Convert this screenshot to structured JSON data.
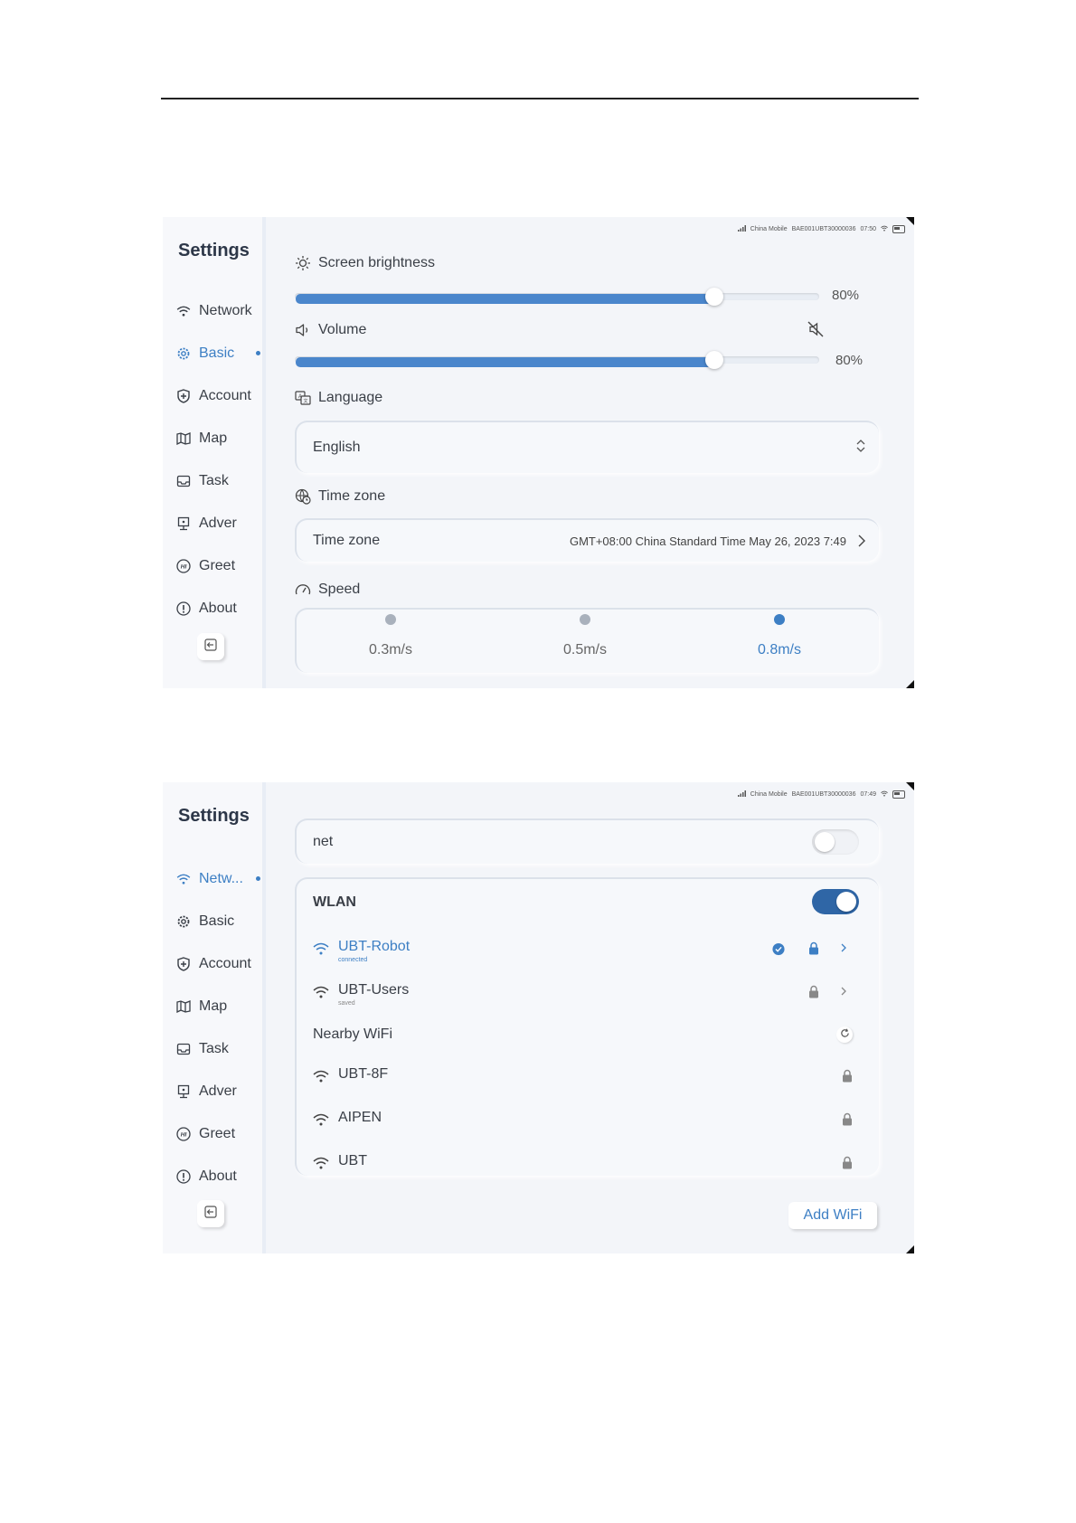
{
  "settings_screen": {
    "status_bar": {
      "carrier": "China Mobile",
      "device_id": "BAE001UBT30000036",
      "time": "07:50"
    },
    "sidebar": {
      "title": "Settings",
      "items": [
        {
          "label": "Network",
          "icon": "wifi-icon"
        },
        {
          "label": "Basic",
          "icon": "gear-icon",
          "active": true
        },
        {
          "label": "Account",
          "icon": "shield-icon"
        },
        {
          "label": "Map",
          "icon": "map-icon"
        },
        {
          "label": "Task",
          "icon": "inbox-icon"
        },
        {
          "label": "Adver",
          "icon": "billboard-icon"
        },
        {
          "label": "Greet",
          "icon": "hi-icon"
        },
        {
          "label": "About",
          "icon": "info-icon"
        }
      ]
    },
    "brightness": {
      "label": "Screen brightness",
      "value_text": "80%",
      "level": 0.8
    },
    "volume": {
      "label": "Volume",
      "value_text": "80%",
      "level": 0.8,
      "mute_icon": "mute-icon"
    },
    "language": {
      "label": "Language",
      "selected": "English"
    },
    "timezone": {
      "label": "Time zone",
      "row_label": "Time zone",
      "value": "GMT+08:00 China Standard Time  May 26, 2023  7:49"
    },
    "speed": {
      "label": "Speed",
      "options": [
        {
          "label": "0.3m/s",
          "selected": false
        },
        {
          "label": "0.5m/s",
          "selected": false
        },
        {
          "label": "0.8m/s",
          "selected": true
        }
      ]
    }
  },
  "network_screen": {
    "status_bar": {
      "carrier": "China Mobile",
      "device_id": "BAE001UBT30000036",
      "time": "07:49"
    },
    "sidebar": {
      "title": "Settings",
      "items": [
        {
          "label": "Netw...",
          "icon": "wifi-icon",
          "active": true
        },
        {
          "label": "Basic",
          "icon": "gear-icon"
        },
        {
          "label": "Account",
          "icon": "shield-icon"
        },
        {
          "label": "Map",
          "icon": "map-icon"
        },
        {
          "label": "Task",
          "icon": "inbox-icon"
        },
        {
          "label": "Adver",
          "icon": "billboard-icon"
        },
        {
          "label": "Greet",
          "icon": "hi-icon"
        },
        {
          "label": "About",
          "icon": "info-icon"
        }
      ]
    },
    "net": {
      "label": "net",
      "enabled": false
    },
    "wlan": {
      "title": "WLAN",
      "enabled": true,
      "saved_networks": [
        {
          "name": "UBT-Robot",
          "status": "connected"
        },
        {
          "name": "UBT-Users",
          "status": "saved"
        }
      ],
      "nearby_title": "Nearby WiFi",
      "nearby": [
        {
          "name": "UBT-8F"
        },
        {
          "name": "AIPEN"
        },
        {
          "name": "UBT"
        }
      ]
    },
    "add_button": "Add WiFi"
  },
  "colors": {
    "accent": "#3d7fc4",
    "toggle_on": "#2f66a6",
    "slider_fill": "#4a86cc",
    "background": "#f3f5f9"
  }
}
